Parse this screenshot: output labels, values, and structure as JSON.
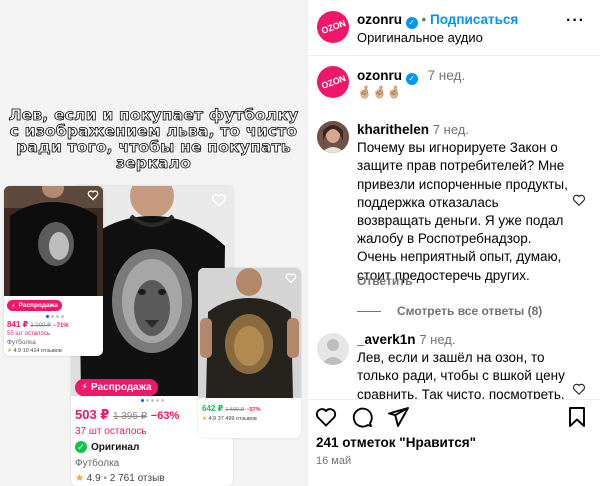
{
  "media": {
    "caption_lines": [
      "Лев, если и покупает футболку",
      "с изображением льва, то чисто",
      "ради того, чтобы не покупать",
      "зеркало"
    ],
    "cards": {
      "small_left": {
        "sale_label": "Распродажа",
        "price": "841 ₽",
        "old_price": "3 000 ₽",
        "discount": "−71%",
        "stock": "55 шт осталось",
        "kind": "Футболка",
        "rating": "4.9",
        "reviews": "10 414 отзывов"
      },
      "center": {
        "sale_label": "Распродажа",
        "price": "503 ₽",
        "old_price": "1 395 ₽",
        "discount": "−63%",
        "stock": "37 шт осталось",
        "original_label": "Оригинал",
        "kind": "Футболка",
        "rating": "4.9",
        "reviews": "2 761 отзыв"
      },
      "small_right": {
        "price": "642 ₽",
        "old_price": "1 500 ₽",
        "discount": "−57%",
        "rating": "4.9",
        "reviews": "37 499 отзывов"
      }
    }
  },
  "header": {
    "username": "ozonru",
    "follow_label": "Подписаться",
    "audio": "Оригинальное аудио",
    "avatar_text": "OZON"
  },
  "post": {
    "username": "ozonru",
    "time": "7 нед.",
    "text": "🤞🏼🤞🏼🤞🏼"
  },
  "comments": [
    {
      "username": "kharithelen",
      "time": "7 нед.",
      "text": "Почему вы игнорируете Закон о защите прав потребителей? Мне привезли испорченные продукты, поддержка отказалась возвращать деньги. Я уже подал жалобу в Роспотребнадзор. Очень неприятный опыт, думаю, стоит предостеречь других.",
      "reply_label": "Ответить",
      "view_replies": "Смотреть все ответы (8)"
    },
    {
      "username": "_averk1n",
      "time": "7 нед.",
      "text": "Лев, если и зашёл на озон, то только ради, чтобы с вшкой цену сравнить. Так чисто, посмотреть,"
    }
  ],
  "footer": {
    "likes": "241 отметок \"Нравится\"",
    "date": "16 май"
  },
  "colors": {
    "ozon_pink": "#f0176b",
    "ig_blue": "#0095f6",
    "muted": "#737373"
  },
  "icons": [
    "heart-icon",
    "comment-icon",
    "share-icon",
    "bookmark-icon",
    "more-icon",
    "verified-icon"
  ]
}
